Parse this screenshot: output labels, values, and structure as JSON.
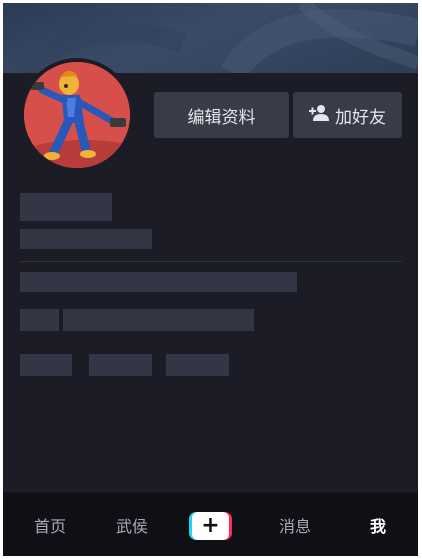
{
  "profile": {
    "edit_label": "编辑资料",
    "add_friend_label": "加好友",
    "add_friend_icon": "user-plus-icon",
    "avatar_icon": "cartoon-avatar-icon"
  },
  "tabbar": {
    "items": [
      {
        "label": "首页",
        "active": false
      },
      {
        "label": "武侯",
        "active": false
      },
      {
        "label": "消息",
        "active": false
      },
      {
        "label": "我",
        "active": true
      }
    ],
    "create_icon": "plus-icon",
    "create_symbol": "+"
  },
  "colors": {
    "background": "#1b1c26",
    "button": "#3a3b48",
    "placeholder": "#343645",
    "accent_cyan": "#20d5ec",
    "accent_red": "#fe2c55"
  }
}
